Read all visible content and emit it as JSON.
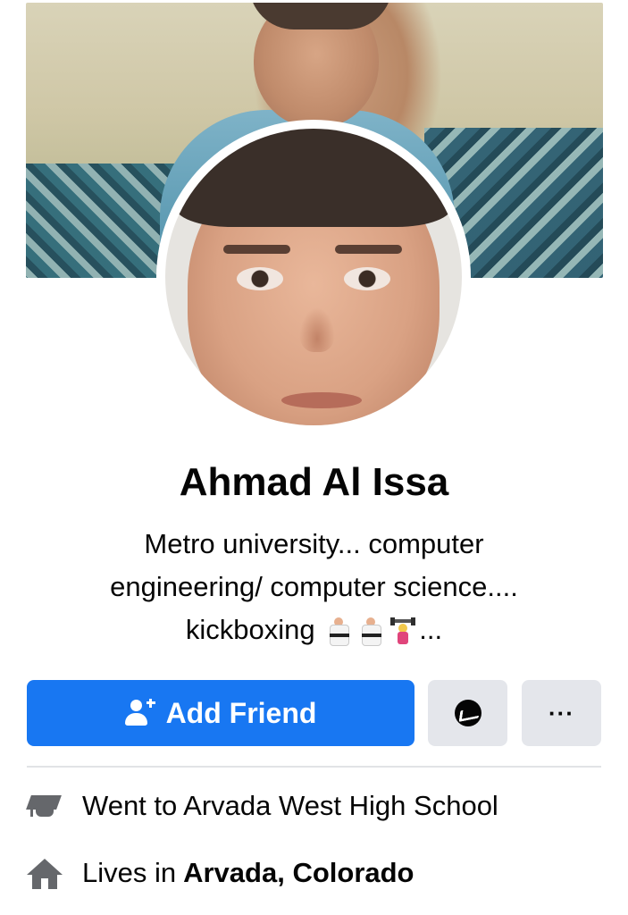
{
  "profile": {
    "name": "Ahmad Al Issa",
    "bio_lines": [
      "Metro university... computer",
      "engineering/ computer science....",
      "kickboxing"
    ],
    "bio_trailing": "...",
    "bio_emojis": [
      "martial-arts-uniform",
      "martial-arts-uniform",
      "woman-lifting-weights"
    ]
  },
  "actions": {
    "add_friend_label": "Add Friend",
    "more_label": "···"
  },
  "info": {
    "education_text": "Went to Arvada West High School",
    "lives_prefix": "Lives in",
    "lives_place": "Arvada, Colorado"
  },
  "colors": {
    "primary_blue": "#1877f2",
    "secondary_button": "#e4e6eb",
    "icon_gray": "#65676b"
  }
}
